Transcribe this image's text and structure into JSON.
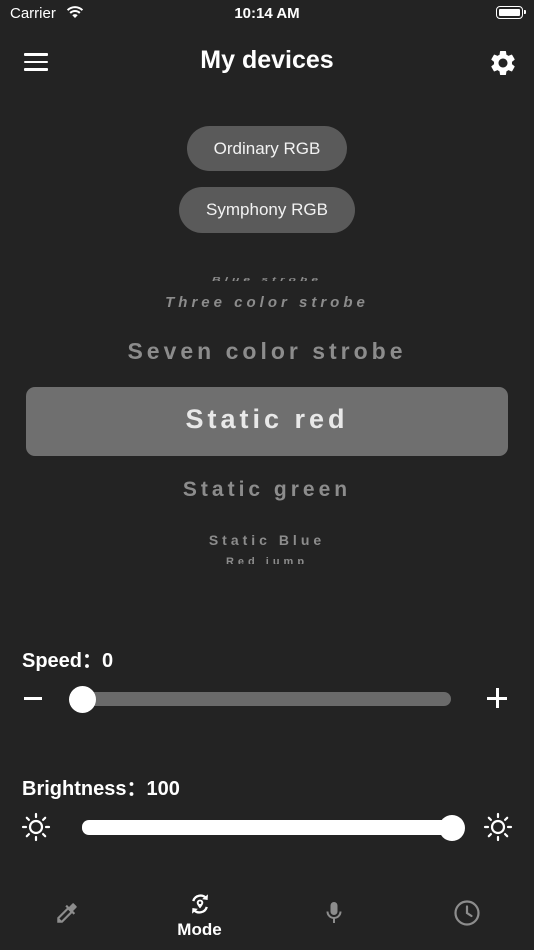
{
  "status_bar": {
    "carrier": "Carrier",
    "time": "10:14 AM"
  },
  "nav": {
    "title": "My devices",
    "menu_icon": "menu-icon",
    "settings_icon": "gear-icon"
  },
  "mode_buttons": [
    {
      "label": "Ordinary RGB"
    },
    {
      "label": "Symphony RGB"
    }
  ],
  "picker": {
    "items_above": [
      "Blue strobe",
      "Three color strobe",
      "Seven color strobe"
    ],
    "selected": "Static red",
    "items_below": [
      "Static green",
      "Static Blue",
      "Red jump"
    ]
  },
  "speed": {
    "label": "Speed：",
    "value": "0",
    "level": 0
  },
  "brightness": {
    "label": "Brightness：",
    "value": "100",
    "level": 100
  },
  "tabs": [
    {
      "icon": "color-picker-icon",
      "label": ""
    },
    {
      "icon": "mode-icon",
      "label": "Mode"
    },
    {
      "icon": "microphone-icon",
      "label": ""
    },
    {
      "icon": "clock-icon",
      "label": ""
    }
  ],
  "colors": {
    "background": "#232323",
    "button": "#5a5a5a",
    "picker_selected": "#6f6f6f"
  }
}
